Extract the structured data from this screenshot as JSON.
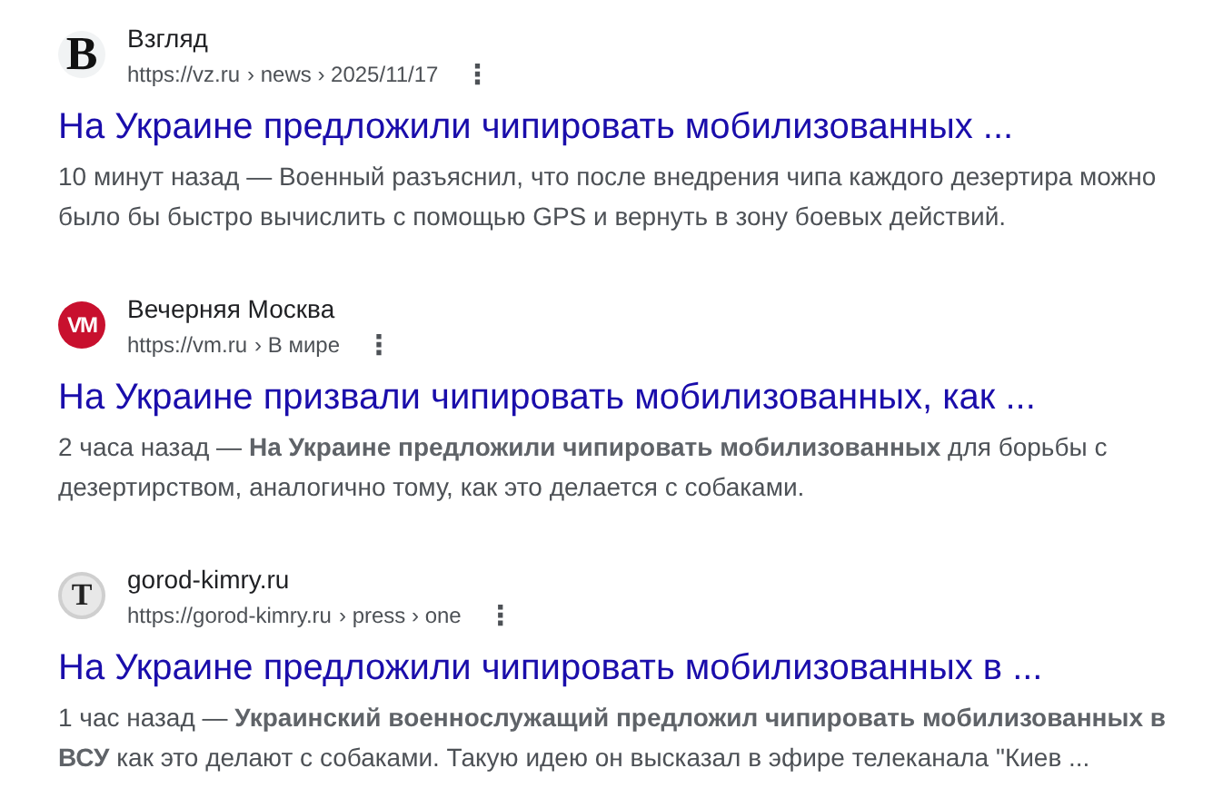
{
  "results": [
    {
      "logo": {
        "kind": "letter",
        "text": "B"
      },
      "site": "Взгляд",
      "url": "https://vz.ru",
      "path": "› news › 2025/11/17",
      "menu": "⋮",
      "title": "На Украине предложили чипировать мобилизованных ...",
      "snippet": "10 минут назад — Военный разъяснил, что после внедрения чипа каждого дезертира можно было бы быстро вычислить с помощью GPS и вернуть в зону боевых действий."
    },
    {
      "logo": {
        "kind": "badge",
        "text": "VM"
      },
      "site": "Вечерняя Москва",
      "url": "https://vm.ru",
      "path": "› В мире",
      "menu": "⋮",
      "title": "На Украине призвали чипировать мобилизованных, как ...",
      "snippet": "2 часа назад — **На Украине предложили чипировать мобилизованных** для борьбы с дезертирством, аналогично тому, как это делается с собаками."
    },
    {
      "logo": {
        "kind": "seal",
        "text": "T"
      },
      "site": "gorod-kimry.ru",
      "url": "https://gorod-kimry.ru",
      "path": "› press › one",
      "menu": "⋮",
      "title": "На Украине предложили чипировать мобилизованных в ...",
      "snippet": "1 час назад — **Украинский военнослужащий предложил чипировать мобилизованных в ВСУ** как это делают с собаками. Такую идею он высказал в эфире телеканала \"Киев ..."
    }
  ]
}
